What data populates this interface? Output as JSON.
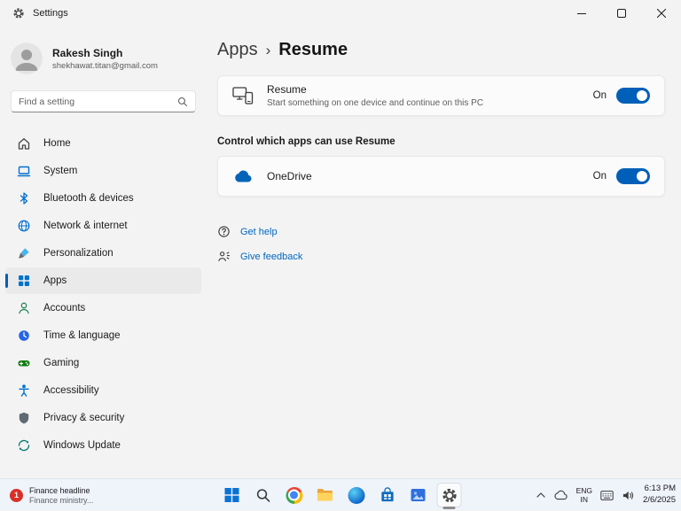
{
  "colors": {
    "accent": "#005fb8",
    "link": "#0067c0",
    "toggle_on": "#005fb8",
    "onedrive_blue": "#0364b8",
    "badge_red": "#d93025"
  },
  "titlebar": {
    "app_name": "Settings"
  },
  "sidebar": {
    "user": {
      "name": "Rakesh Singh",
      "email": "shekhawat.titan@gmail.com"
    },
    "search": {
      "placeholder": "Find a setting"
    },
    "items": [
      {
        "label": "Home",
        "icon": "home-icon",
        "selected": false
      },
      {
        "label": "System",
        "icon": "system-icon",
        "selected": false
      },
      {
        "label": "Bluetooth & devices",
        "icon": "bluetooth-icon",
        "selected": false
      },
      {
        "label": "Network & internet",
        "icon": "network-icon",
        "selected": false
      },
      {
        "label": "Personalization",
        "icon": "personalization-icon",
        "selected": false
      },
      {
        "label": "Apps",
        "icon": "apps-icon",
        "selected": true
      },
      {
        "label": "Accounts",
        "icon": "accounts-icon",
        "selected": false
      },
      {
        "label": "Time & language",
        "icon": "time-language-icon",
        "selected": false
      },
      {
        "label": "Gaming",
        "icon": "gaming-icon",
        "selected": false
      },
      {
        "label": "Accessibility",
        "icon": "accessibility-icon",
        "selected": false
      },
      {
        "label": "Privacy & security",
        "icon": "privacy-icon",
        "selected": false
      },
      {
        "label": "Windows Update",
        "icon": "windows-update-icon",
        "selected": false
      }
    ]
  },
  "main": {
    "breadcrumb": {
      "parent": "Apps",
      "separator": "›",
      "current": "Resume"
    },
    "resume_card": {
      "title": "Resume",
      "description": "Start something on one device and continue on this PC",
      "toggle_label": "On",
      "toggle_state": true
    },
    "section_header": "Control which apps can use Resume",
    "onedrive_card": {
      "title": "OneDrive",
      "toggle_label": "On",
      "toggle_state": true
    },
    "help_link": "Get help",
    "feedback_link": "Give feedback"
  },
  "taskbar": {
    "widget": {
      "badge": "1",
      "headline": "Finance headline",
      "subline": "Finance ministry..."
    },
    "tray": {
      "lang_line1": "ENG",
      "lang_line2": "IN",
      "time": "6:13 PM",
      "date": "2/6/2025"
    }
  }
}
